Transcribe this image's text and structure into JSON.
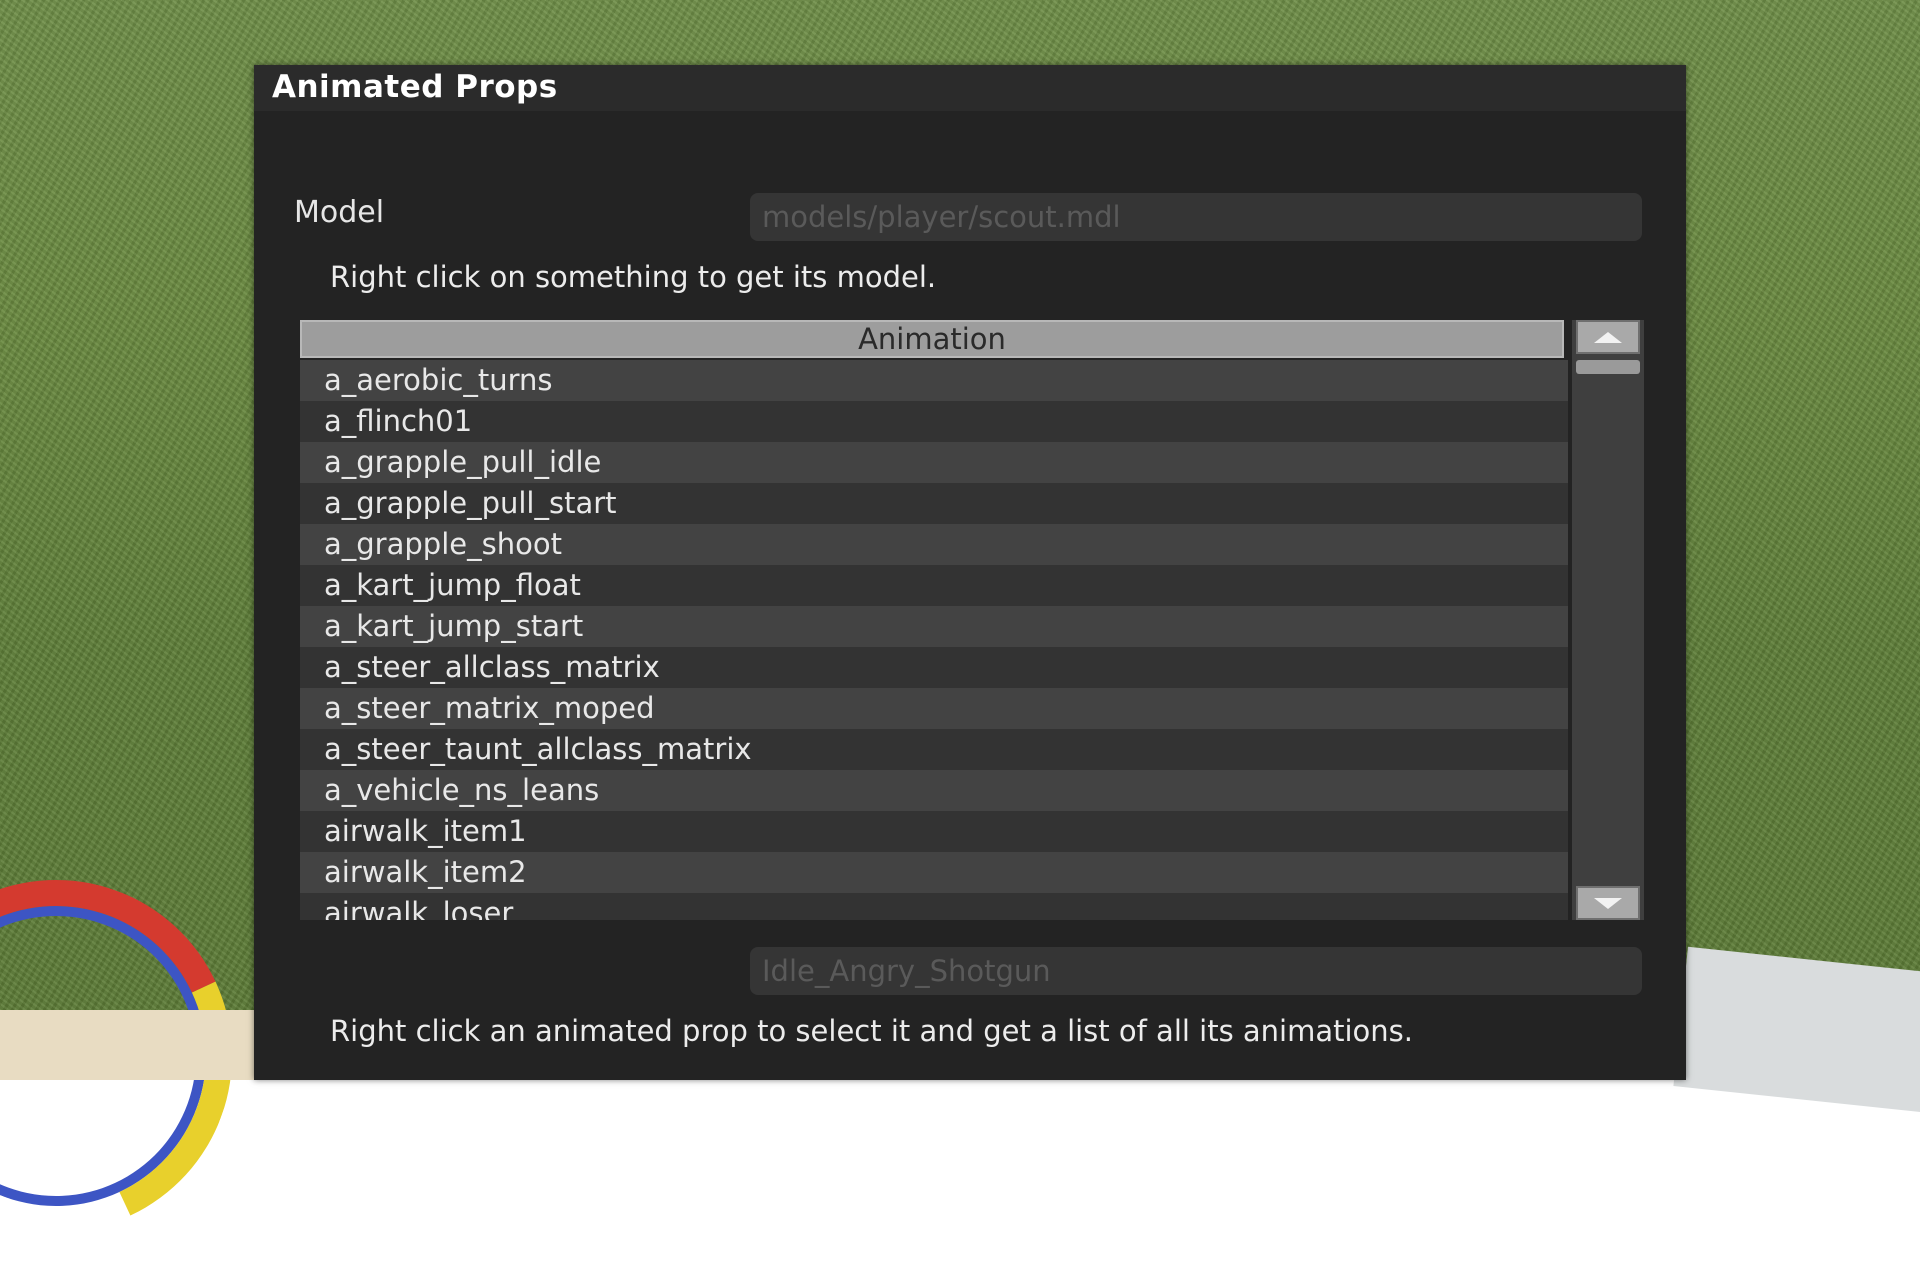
{
  "window": {
    "title": "Animated Props"
  },
  "model": {
    "label": "Model",
    "value": "models/player/scout.mdl",
    "hint": "Right click on something to get its model."
  },
  "animation_list": {
    "column_header": "Animation",
    "items": [
      "a_aerobic_turns",
      "a_flinch01",
      "a_grapple_pull_idle",
      "a_grapple_pull_start",
      "a_grapple_shoot",
      "a_kart_jump_float",
      "a_kart_jump_start",
      "a_steer_allclass_matrix",
      "a_steer_matrix_moped",
      "a_steer_taunt_allclass_matrix",
      "a_vehicle_ns_leans",
      "airwalk_item1",
      "airwalk_item2",
      "airwalk_loser"
    ]
  },
  "selected_animation": {
    "value": "Idle_Angry_Shotgun",
    "hint": "Right click an animated prop to select it and get a list of all its animations."
  },
  "scrollbar": {
    "up_icon": "arrow-up-icon",
    "down_icon": "arrow-down-icon"
  },
  "colors": {
    "panel_bg": "#232323",
    "header_bg": "#9d9d9d",
    "row_light": "#434343",
    "row_dark": "#333333"
  }
}
